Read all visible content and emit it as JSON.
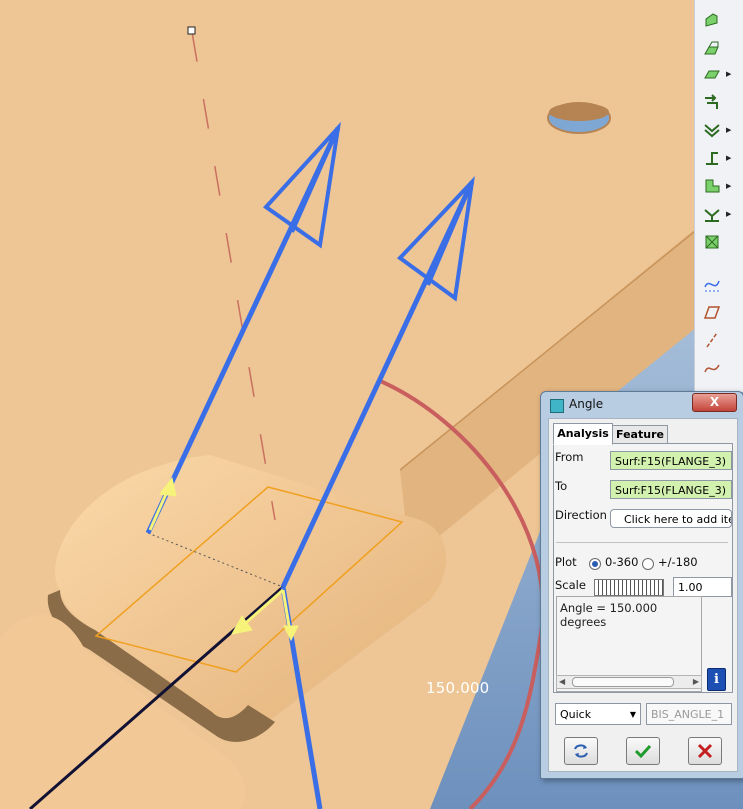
{
  "dialog": {
    "title": "Angle",
    "close_label": "X",
    "tabs": [
      {
        "label": "Analysis",
        "active": true
      },
      {
        "label": "Feature",
        "active": false
      }
    ],
    "from_label": "From",
    "from_value": "Surf:F15(FLANGE_3)",
    "to_label": "To",
    "to_value": "Surf:F15(FLANGE_3)",
    "direction_label": "Direction",
    "direction_value": "Click here to add ite",
    "plot_label": "Plot",
    "plot_options": [
      "0-360",
      "+/-180"
    ],
    "plot_selected": "0-360",
    "scale_label": "Scale",
    "scale_value": "1.00",
    "result_text": "Angle = 150.000 degrees",
    "mode_value": "Quick",
    "name_value": "BIS_ANGLE_1",
    "buttons": {
      "repeat": "repeat-icon",
      "ok": "check-icon",
      "cancel": "cancel-icon"
    }
  },
  "viewport": {
    "angle_readout": "150.000"
  },
  "toolbar": {
    "icons": [
      "wall-icon",
      "flat-wall-icon",
      "flange-icon",
      "extend-icon",
      "bend-icon",
      "unbend-icon",
      "form-icon",
      "flatten-icon",
      "convert-icon",
      "datum-curve-icon",
      "datum-plane-icon",
      "datum-axis-icon",
      "sketch-curve-icon"
    ]
  },
  "colors": {
    "part": "#eec594",
    "background": "#7e9fc6",
    "vector": "#3a6ee6",
    "arc": "#d06060",
    "selection": "#f0a020"
  }
}
